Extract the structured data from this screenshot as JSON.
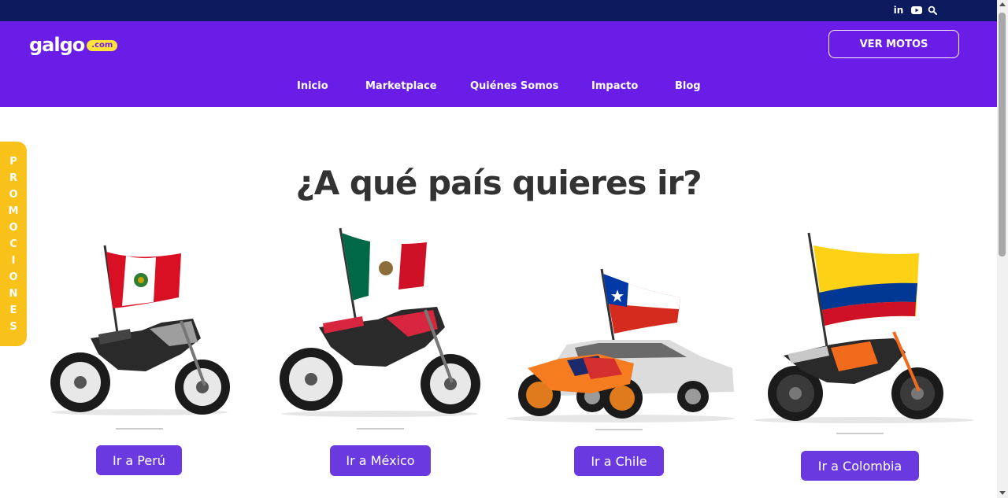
{
  "topbar": {
    "social_icons": [
      "linkedin-icon",
      "youtube-icon",
      "search-icon"
    ],
    "linkedin_text": "in"
  },
  "header": {
    "logo": {
      "word": "galgo",
      "badge": ".com"
    },
    "cta_label": "VER MOTOS",
    "nav": [
      "Inicio",
      "Marketplace",
      "Quiénes Somos",
      "Impacto",
      "Blog"
    ]
  },
  "promo_tab": {
    "letters": [
      "P",
      "R",
      "O",
      "M",
      "O",
      "C",
      "I",
      "O",
      "N",
      "E",
      "S"
    ]
  },
  "main": {
    "heading": "¿A qué país quieres ir?",
    "countries": [
      {
        "button": "Ir a Perú",
        "flag": "peru-flag",
        "vehicle": "motorcycle"
      },
      {
        "button": "Ir a México",
        "flag": "mexico-flag",
        "vehicle": "motorcycle"
      },
      {
        "button": "Ir a Chile",
        "flag": "chile-flag",
        "vehicle": "motorcycle-and-suv"
      },
      {
        "button": "Ir a Colombia",
        "flag": "colombia-flag",
        "vehicle": "motorcycle"
      }
    ]
  },
  "colors": {
    "topbar": "#0c1a5e",
    "header": "#6a1de6",
    "button": "#6a3ae0",
    "promo": "#f9c21b",
    "logo_badge": "#ffe33b",
    "heading": "#333333"
  }
}
